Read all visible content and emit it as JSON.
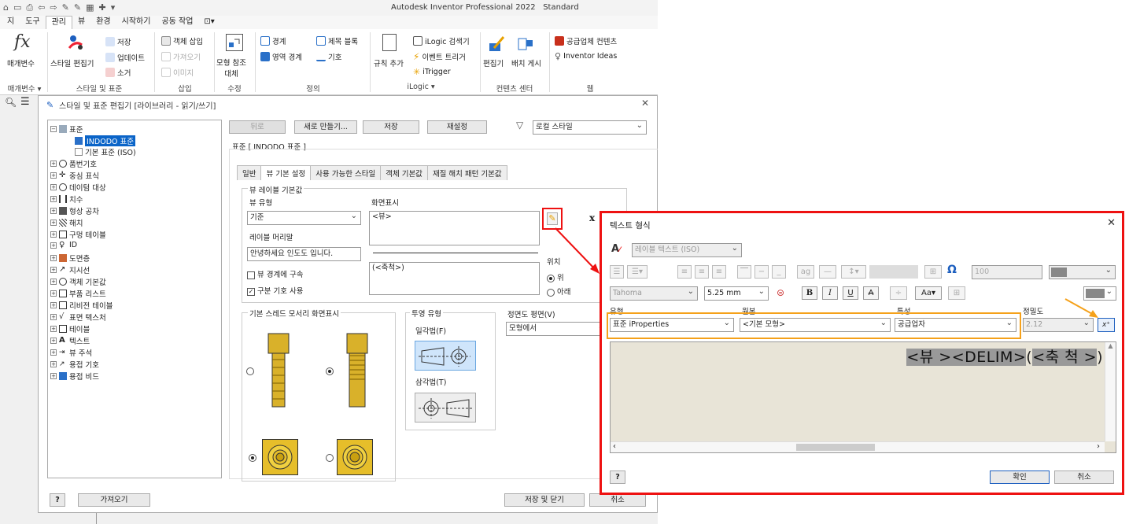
{
  "app": {
    "title": "Autodesk Inventor Professional 2022",
    "edition": "Standard",
    "quick_access": [
      "⌂",
      "▭",
      "⎙",
      "⇦",
      "⇨",
      "✎",
      "✎",
      "▦",
      "✚",
      "▾"
    ]
  },
  "menu": {
    "tabs": [
      "지",
      "도구",
      "관리",
      "뷰",
      "환경",
      "시작하기",
      "공동 작업",
      "⊡▾"
    ],
    "active_index": 2
  },
  "ribbon": {
    "param_label": "매개변수",
    "param_group": "매개변수 ▾",
    "style_editor": "스타일 편집기",
    "style_save": "저장",
    "style_update": "업데이트",
    "style_purge": "소거",
    "style_group": "스타일 및 표준",
    "insert_object": "객체 삽입",
    "insert_import": "가져오기",
    "insert_image": "이미지",
    "insert_group": "삽입",
    "replace_model": "모형 참조",
    "replace_model2": "대체",
    "modify_group": "수정",
    "def_border": "경계",
    "def_zone_border": "영역 경계",
    "def_title_block": "제목 블록",
    "def_symbol": "기호",
    "define_group": "정의",
    "ilogic_add_rule": "규칙 추가",
    "ilogic_browser": "iLogic 검색기",
    "ilogic_event_trigger": "이벤트 트리거",
    "ilogic_itrigger": "iTrigger",
    "ilogic_group": "iLogic ▾",
    "content_edit": "편집기",
    "content_publish": "배치 게시",
    "content_group": "컨텐츠 센터",
    "web_shared": "공급업체 컨텐츠",
    "web_ideas": "Inventor Ideas",
    "web_group": "웹"
  },
  "style_editor_dialog": {
    "title": "스타일 및 표준 편집기 [라이브러리 - 읽기/쓰기]",
    "tree": [
      {
        "label": "표준",
        "level": 0,
        "expanded": true
      },
      {
        "label": "INDODO 표준",
        "level": 1,
        "selected": true
      },
      {
        "label": "기본 표준 (ISO)",
        "level": 1
      },
      {
        "label": "품번기호",
        "level": 0
      },
      {
        "label": "중심 표식",
        "level": 0
      },
      {
        "label": "데이텀 대상",
        "level": 0
      },
      {
        "label": "치수",
        "level": 0
      },
      {
        "label": "형상 공차",
        "level": 0
      },
      {
        "label": "해치",
        "level": 0
      },
      {
        "label": "구멍 테이블",
        "level": 0
      },
      {
        "label": "ID",
        "level": 0
      },
      {
        "label": "도면층",
        "level": 0
      },
      {
        "label": "지시선",
        "level": 0
      },
      {
        "label": "객체 기본값",
        "level": 0
      },
      {
        "label": "부품 리스트",
        "level": 0
      },
      {
        "label": "리비전 테이블",
        "level": 0
      },
      {
        "label": "표면 텍스처",
        "level": 0
      },
      {
        "label": "테이블",
        "level": 0
      },
      {
        "label": "텍스트",
        "level": 0
      },
      {
        "label": "뷰 주석",
        "level": 0
      },
      {
        "label": "용접 기호",
        "level": 0
      },
      {
        "label": "용접 비드",
        "level": 0
      }
    ],
    "buttons": {
      "back": "뒤로",
      "new": "새로 만들기...",
      "save": "저장",
      "reset": "재설정"
    },
    "filter_value": "로컬 스타일",
    "standard_heading": "표준 [ INDODO 표준 ]",
    "tabs": [
      "일반",
      "뷰 기본 설정",
      "사용 가능한 스타일",
      "객체 기본값",
      "재질 해치 패턴 기본값"
    ],
    "active_tab": 1,
    "view_label_defaults": "뷰 레이블 기본값",
    "view_type_label": "뷰 유형",
    "view_type_value": "기준",
    "display_label": "화면표시",
    "display_value": "<뷰>",
    "label_prefix_label": "레이블 머리말",
    "label_prefix_value": "안녕하세요 인도도 입니다.",
    "display_value2": "(<축척>)",
    "constrain_to_border": "뷰 경계에 구속",
    "constrain_checked": false,
    "use_symbol": "구분 기호 사용",
    "use_symbol_checked": true,
    "position_label": "위치",
    "position_options": [
      "위",
      "아래"
    ],
    "position_selected": 0,
    "thread_edge_heading": "기본 스레드 모서리 화면표시",
    "projection_type_heading": "투영 유형",
    "first_angle": "일각법(F)",
    "third_angle": "삼각법(T)",
    "front_plane_heading": "정면도 평면(V)",
    "front_plane_value": "모형에서",
    "import_button": "가져오기",
    "save_close_button": "저장 및 닫기",
    "cancel_button": "취소",
    "help": "?"
  },
  "text_format_dialog": {
    "title": "텍스트 형식",
    "style_value": "레이블 텍스트 (ISO)",
    "font_value": "Tahoma",
    "size_value": "5.25 mm",
    "spacing_value": "100",
    "type_label": "유형",
    "type_value": "표준 iProperties",
    "source_label": "원본",
    "source_value": "<기본 모형>",
    "property_label": "특성",
    "property_value": "공급업자",
    "precision_label": "정밀도",
    "precision_value": "2.12",
    "editor_tokens": [
      "<뷰 >",
      "<DELIM>",
      "(",
      "<축 척 >",
      ")"
    ],
    "ok_button": "확인",
    "cancel_button": "취소",
    "help": "?",
    "format_buttons": {
      "bold": "B",
      "italic": "I",
      "underline": "U",
      "strike": "A"
    },
    "accent_colors": {
      "highlight_box": "#e11",
      "property_box": "#f5a11a",
      "arrow_red": "#e11",
      "arrow_orange": "#f5a11a"
    }
  }
}
